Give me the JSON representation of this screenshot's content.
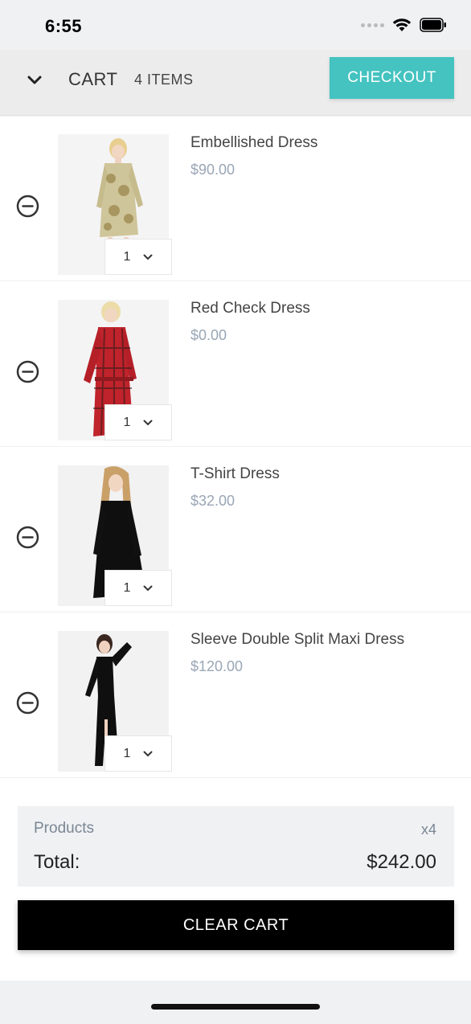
{
  "status_bar": {
    "time": "6:55"
  },
  "header": {
    "title": "CART",
    "items_count": "4 ITEMS",
    "checkout_label": "CHECKOUT"
  },
  "cart": {
    "items": [
      {
        "name": "Embellished Dress",
        "price": "$90.00",
        "quantity": "1"
      },
      {
        "name": "Red Check Dress",
        "price": "$0.00",
        "quantity": "1"
      },
      {
        "name": "T-Shirt Dress",
        "price": "$32.00",
        "quantity": "1"
      },
      {
        "name": "Sleeve Double Split Maxi Dress",
        "price": "$120.00",
        "quantity": "1"
      }
    ]
  },
  "summary": {
    "products_label": "Products",
    "products_count": "x4",
    "total_label": "Total:",
    "total_value": "$242.00"
  },
  "actions": {
    "clear_cart_label": "CLEAR CART"
  },
  "colors": {
    "accent": "#44c3c0",
    "price": "#9aa6b6",
    "primary_button": "#000000"
  }
}
